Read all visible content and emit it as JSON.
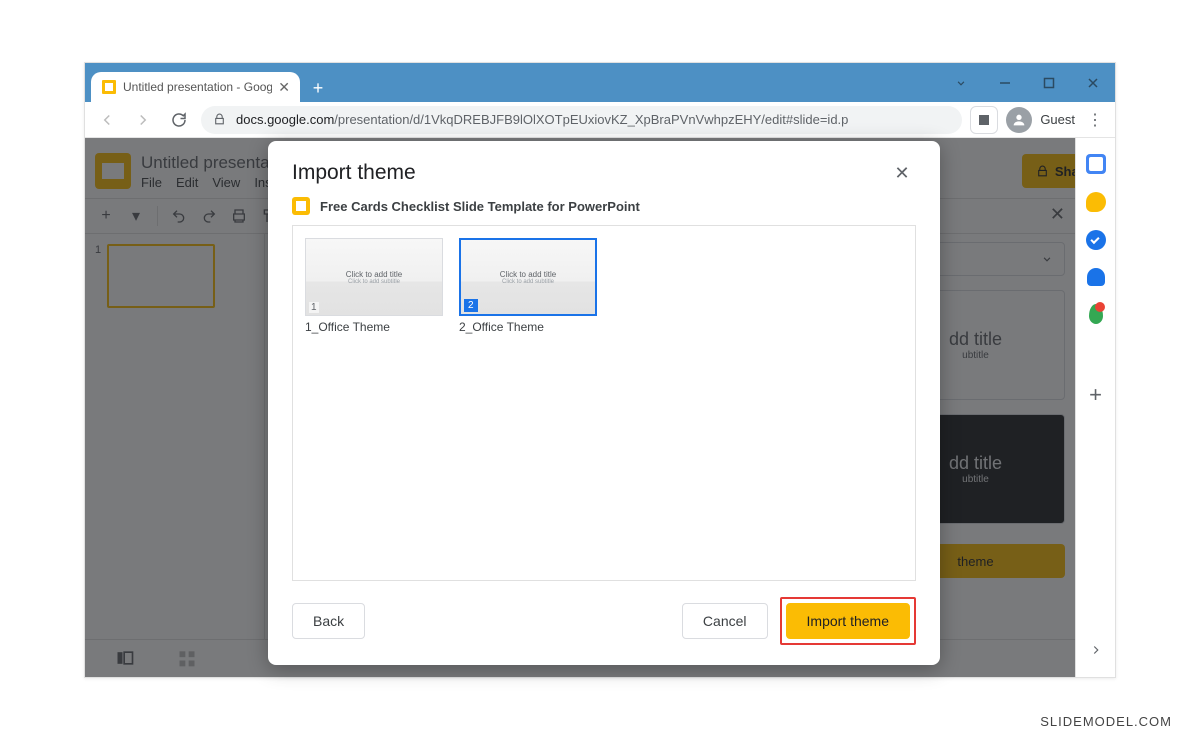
{
  "browser": {
    "tab_title": "Untitled presentation - Google Slides",
    "url_host": "docs.google.com",
    "url_path": "/presentation/d/1VkqDREBJFB9lOlXOTpEUxiovKZ_XpBraPVnVwhpzEHY/edit#slide=id.p",
    "profile": "Guest"
  },
  "app": {
    "title": "Untitled presentation",
    "menus": [
      "File",
      "Edit",
      "View",
      "Insert"
    ],
    "share_label": "Share",
    "thumb_number": "1",
    "themepanel": {
      "tile1": {
        "title": "dd title",
        "sub": "ubtitle"
      },
      "tile2": {
        "title": "dd title",
        "sub": "ubtitle"
      },
      "import_label": "theme"
    }
  },
  "dialog": {
    "title": "Import theme",
    "source": "Free Cards Checklist Slide Template for PowerPoint",
    "themes": [
      {
        "num": "1",
        "label": "1_Office Theme",
        "preview_title": "Click to add title",
        "preview_sub": "Click to add subtitle",
        "selected": false
      },
      {
        "num": "2",
        "label": "2_Office Theme",
        "preview_title": "Click to add title",
        "preview_sub": "Click to add subtitle",
        "selected": true
      }
    ],
    "back_label": "Back",
    "cancel_label": "Cancel",
    "import_label": "Import theme"
  },
  "watermark": "SLIDEMODEL.COM"
}
